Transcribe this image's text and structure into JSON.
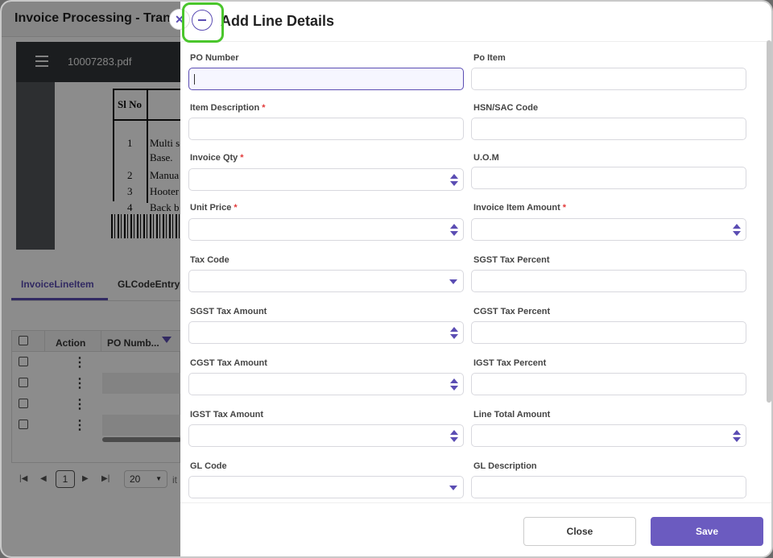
{
  "background": {
    "title": "Invoice Processing - Transa",
    "pdf": {
      "file_name": "10007283.pdf",
      "col_header": "Sl No",
      "rows": [
        {
          "num": "1",
          "desc": "Multi s",
          "desc2": "Base."
        },
        {
          "num": "2",
          "desc": "Manua"
        },
        {
          "num": "3",
          "desc": "Hooter"
        },
        {
          "num": "4",
          "desc": "Back b"
        }
      ]
    },
    "tabs": [
      "InvoiceLineItem",
      "GLCodeEntry"
    ],
    "grid": {
      "headers": {
        "action": "Action",
        "po": "PO Numb..."
      }
    },
    "pager": {
      "current_page": "1",
      "page_size": "20",
      "items_label": "it"
    }
  },
  "dialog": {
    "title": "Add Line Details",
    "close_label": "Close",
    "save_label": "Save",
    "fields": {
      "po_number": {
        "label": "PO Number",
        "value": ""
      },
      "po_item": {
        "label": "Po Item",
        "value": ""
      },
      "item_description": {
        "label": "Item Description",
        "required": "*",
        "value": ""
      },
      "hsn_sac_code": {
        "label": "HSN/SAC Code",
        "value": ""
      },
      "invoice_qty": {
        "label": "Invoice Qty",
        "required": "*",
        "value": ""
      },
      "uom": {
        "label": "U.O.M",
        "value": ""
      },
      "unit_price": {
        "label": "Unit Price",
        "required": "*",
        "value": ""
      },
      "invoice_item_amount": {
        "label": "Invoice Item Amount",
        "required": "*",
        "value": ""
      },
      "tax_code": {
        "label": "Tax Code",
        "value": ""
      },
      "sgst_tax_percent": {
        "label": "SGST Tax Percent",
        "value": ""
      },
      "sgst_tax_amount": {
        "label": "SGST Tax Amount",
        "value": ""
      },
      "cgst_tax_percent": {
        "label": "CGST Tax Percent",
        "value": ""
      },
      "cgst_tax_amount": {
        "label": "CGST Tax Amount",
        "value": ""
      },
      "igst_tax_percent": {
        "label": "IGST Tax Percent",
        "value": ""
      },
      "igst_tax_amount": {
        "label": "IGST Tax Amount",
        "value": ""
      },
      "line_total_amount": {
        "label": "Line Total Amount",
        "value": ""
      },
      "gl_code": {
        "label": "GL Code",
        "value": ""
      },
      "gl_description": {
        "label": "GL Description",
        "value": ""
      }
    },
    "icons": {
      "close": "close-icon",
      "collapse": "minus-icon",
      "spinner": "spinner-arrows-icon",
      "dropdown": "chevron-down-icon"
    },
    "colors": {
      "accent": "#5b4db3",
      "save_button": "#6b5bc0",
      "required": "#e23a3a",
      "highlight": "#4ac62c"
    }
  }
}
